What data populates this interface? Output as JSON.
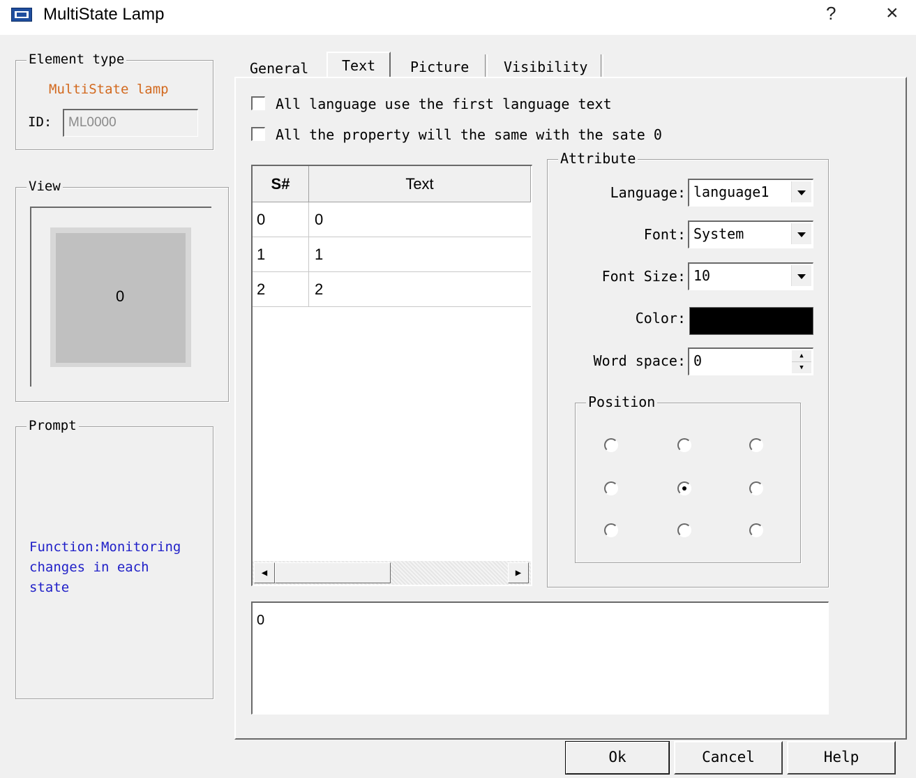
{
  "window": {
    "title": "MultiState Lamp",
    "help": "?",
    "close": "×"
  },
  "element_type": {
    "legend": "Element type",
    "type_name": "MultiState lamp",
    "type_color": "#d2691e",
    "id_label": "ID:",
    "id_value": "ML0000"
  },
  "view": {
    "legend": "View",
    "preview_value": "0"
  },
  "prompt": {
    "legend": "Prompt",
    "text_line1": "Function:Monitoring",
    "text_line2": "changes in each",
    "text_line3": "state",
    "text_color": "#2020c8"
  },
  "tabs": [
    {
      "label": "General"
    },
    {
      "label": "Text",
      "active": true
    },
    {
      "label": "Picture"
    },
    {
      "label": "Visibility"
    }
  ],
  "text_tab": {
    "checkbox_first_language": {
      "label": "All language use the first language text",
      "checked": false
    },
    "checkbox_same_property": {
      "label": "All the property will the same with the sate 0",
      "checked": false
    },
    "grid": {
      "headers": [
        "S#",
        "Text"
      ],
      "rows": [
        {
          "state": "0",
          "text": "0"
        },
        {
          "state": "1",
          "text": "1"
        },
        {
          "state": "2",
          "text": "2"
        }
      ]
    },
    "text_edit_value": "0",
    "attribute": {
      "legend": "Attribute",
      "language_label": "Language:",
      "language_value": "language1",
      "font_label": "Font:",
      "font_value": "System",
      "font_size_label": "Font Size:",
      "font_size_value": "10",
      "color_label": "Color:",
      "color_value": "#000000",
      "word_space_label": "Word space:",
      "word_space_value": "0",
      "position": {
        "legend": "Position",
        "selected": "middle-center"
      }
    }
  },
  "buttons": {
    "ok": "Ok",
    "cancel": "Cancel",
    "help": "Help"
  }
}
